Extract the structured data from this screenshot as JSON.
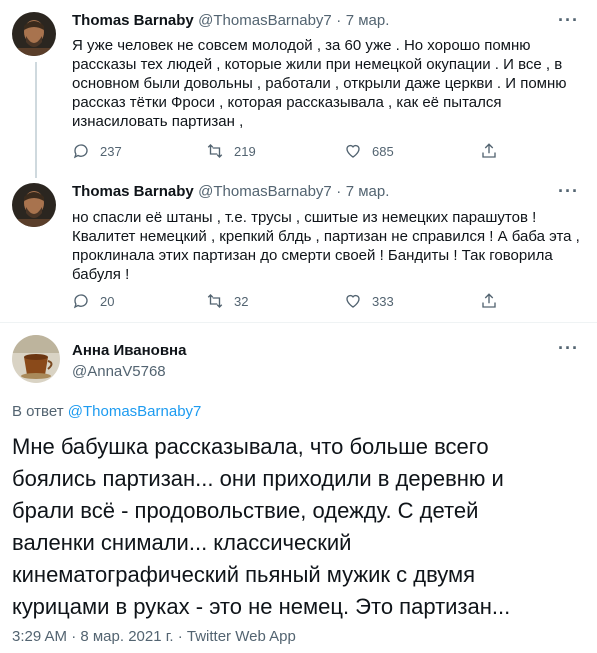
{
  "tweets": [
    {
      "name": "Thomas Barnaby",
      "handle": "@ThomasBarnaby7",
      "sep": "·",
      "date": "7 мар.",
      "lines": [
        "Я уже человек не совсем молодой , за 60 уже . Но хорошо помню",
        "рассказы тех людей , которые жили при немецкой окупации . И все , в",
        "основном  были довольны , работали , открыли даже церкви . И помню",
        "рассказ тётки Фроси , которая рассказывала , как её пытался",
        "изнасиловать партизан ,"
      ],
      "reply_count": "237",
      "retweet_count": "219",
      "like_count": "685"
    },
    {
      "name": "Thomas Barnaby",
      "handle": "@ThomasBarnaby7",
      "sep": "·",
      "date": "7 мар.",
      "lines": [
        "но спасли её штаны , т.е. трусы , сшитые из немецких парашутов !",
        "Квалитет немецкий , крепкий блдь , партизан не справился ! А баба эта ,",
        "проклинала этих партизан до смерти своей ! Бандиты ! Так говорила",
        "бабуля !"
      ],
      "reply_count": "20",
      "retweet_count": "32",
      "like_count": "333"
    }
  ],
  "main": {
    "name": "Анна Ивановна",
    "handle": "@AnnaV5768",
    "reply_prefix": "В ответ",
    "reply_handle": "@ThomasBarnaby7",
    "lines": [
      "Мне бабушка рассказывала, что больше всего",
      "боялись партизан... они приходили в деревню и",
      "брали всё - продовольствие, одежду. С детей",
      "валенки снимали... классический",
      "кинематографический пьяный мужик с двумя",
      "курицами в руках - это не немец. Это партизан..."
    ],
    "footer": "3:29 AM · 8 мар. 2021 г. · Twitter Web App"
  },
  "more_label": "···",
  "colors": {
    "link": "#1d9bf0",
    "muted": "#536471",
    "thread": "#cfd9de"
  }
}
